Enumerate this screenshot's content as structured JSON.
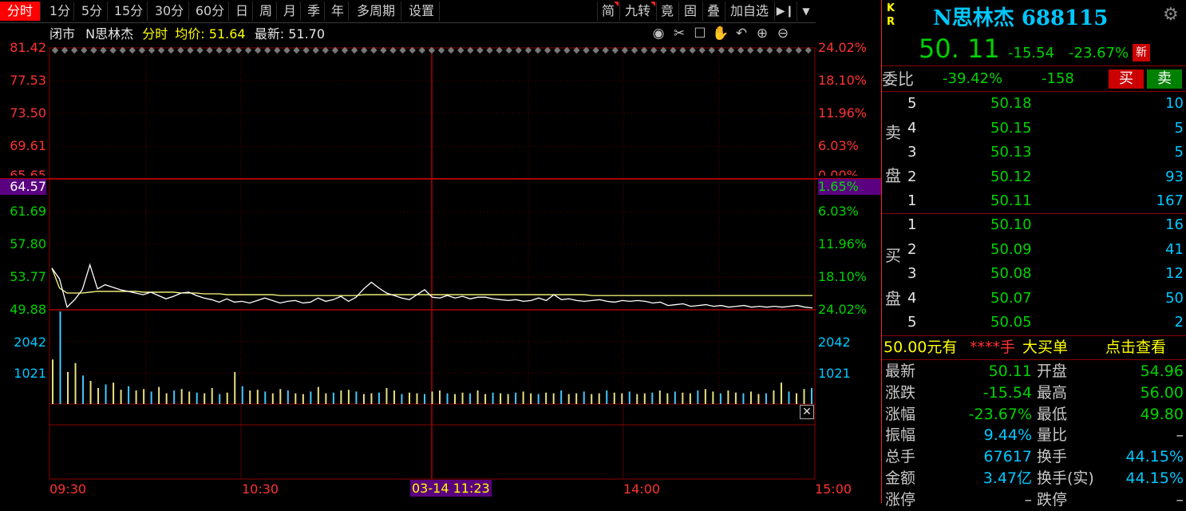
{
  "toolbar": {
    "left_items": [
      "分时",
      "1分",
      "5分",
      "15分",
      "30分",
      "60分",
      "日",
      "周",
      "月",
      "季",
      "年",
      "多周期",
      "设置"
    ],
    "right_items": [
      "简",
      "九转",
      "竟",
      "固",
      "叠",
      "加自选"
    ],
    "active": "分时"
  },
  "info": {
    "status": "闭市",
    "name": "N思林杰",
    "mode": "分时",
    "avg_label": "均价:",
    "avg_value": "51.64",
    "latest_label": "最新:",
    "latest_value": "51.70"
  },
  "left_axis": [
    "81.42",
    "77.53",
    "73.50",
    "69.61",
    "65.65",
    "64.57",
    "61.69",
    "57.80",
    "53.77",
    "49.88"
  ],
  "right_axis": [
    "24.02%",
    "18.10%",
    "11.96%",
    "6.03%",
    "0.00%",
    "1.65%",
    "6.03%",
    "11.96%",
    "18.10%",
    "24.02%"
  ],
  "volume_axis": [
    "2042",
    "1021"
  ],
  "time_axis": [
    "09:30",
    "10:30",
    "03-14 11:23",
    "14:00",
    "15:00"
  ],
  "colors": {
    "up": "#ff3232",
    "down": "#00d200",
    "price_line": "#ffffff",
    "avg_line": "#ffff80",
    "crosshair": "#8b0000",
    "grid": "#5a0000"
  },
  "chart_data": {
    "type": "line",
    "series": [
      {
        "values": [
          54.9,
          53.6,
          50.2,
          51.1,
          52.3,
          55.3,
          52.4,
          52.9,
          52.6,
          52.3,
          52.1,
          51.9,
          51.7,
          52.0,
          51.6,
          51.2,
          51.5,
          51.9,
          52.0,
          51.6,
          51.3,
          51.1,
          50.8,
          51.2,
          50.8,
          50.9,
          50.7,
          51.0,
          51.3,
          51.0,
          50.7,
          50.9,
          51.0,
          50.7,
          50.8,
          51.3,
          50.9,
          51.1,
          51.5,
          50.9,
          51.4,
          52.4,
          53.2,
          52.5,
          51.9,
          51.6,
          51.3,
          51.1,
          51.7,
          52.3,
          51.4,
          51.3,
          51.6,
          51.3,
          51.5,
          51.2,
          51.4,
          51.4,
          51.2,
          51.1,
          51.0,
          51.1,
          50.9,
          51.0,
          51.3,
          51.0,
          51.7,
          51.1,
          51.2,
          51.0,
          50.9,
          51.0,
          51.1,
          50.9,
          50.8,
          51.0,
          50.9,
          51.0,
          50.9,
          50.7,
          50.8,
          50.4,
          50.5,
          50.6,
          50.3,
          50.4,
          50.5,
          50.3,
          50.4,
          50.2,
          50.3,
          50.4,
          50.2,
          50.3,
          50.2,
          50.3,
          50.2,
          50.3,
          50.4,
          50.2,
          50.1
        ]
      },
      {
        "values": [
          54.9,
          52.5,
          51.9,
          51.9,
          51.9,
          52.0,
          52.1,
          52.1,
          52.1,
          52.1,
          52.1,
          52.1,
          52.0,
          52.0,
          52.0,
          52.0,
          52.0,
          51.9,
          51.9,
          51.9,
          51.8,
          51.8,
          51.8,
          51.7,
          51.7,
          51.7,
          51.7,
          51.7,
          51.7,
          51.7,
          51.6,
          51.6,
          51.6,
          51.6,
          51.6,
          51.6,
          51.6,
          51.6,
          51.6,
          51.6,
          51.6,
          51.7,
          51.7,
          51.7,
          51.7,
          51.7,
          51.7,
          51.7,
          51.7,
          51.7,
          51.7,
          51.7,
          51.7,
          51.7,
          51.7,
          51.7,
          51.7,
          51.7,
          51.7,
          51.7,
          51.7,
          51.7,
          51.7,
          51.7,
          51.7,
          51.7,
          51.7,
          51.7,
          51.7,
          51.7,
          51.7,
          51.6,
          51.6,
          51.6,
          51.6,
          51.6,
          51.6,
          51.6,
          51.6,
          51.6,
          51.6,
          51.6,
          51.6,
          51.6,
          51.6,
          51.6,
          51.6,
          51.6,
          51.6,
          51.6,
          51.6,
          51.6,
          51.6,
          51.6,
          51.6,
          51.6,
          51.6,
          51.6,
          51.6,
          51.6,
          51.6
        ]
      }
    ],
    "volume": [
      1250,
      2600,
      900,
      1150,
      800,
      650,
      450,
      550,
      600,
      400,
      500,
      380,
      420,
      350,
      480,
      300,
      380,
      420,
      350,
      320,
      300,
      450,
      280,
      320,
      900,
      500,
      380,
      400,
      350,
      300,
      420,
      380,
      300,
      280,
      350,
      480,
      300,
      320,
      380,
      400,
      350,
      280,
      300,
      320,
      450,
      380,
      280,
      320,
      300,
      280,
      350,
      380,
      300,
      280,
      320,
      300,
      380,
      280,
      320,
      300,
      280,
      320,
      350,
      300,
      280,
      320,
      300,
      380,
      280,
      300,
      350,
      280,
      300,
      380,
      320,
      300,
      350,
      280,
      300,
      320,
      380,
      300,
      350,
      320,
      300,
      380,
      420,
      350,
      300,
      380,
      320,
      300,
      350,
      280,
      300,
      380,
      600,
      350,
      300,
      420,
      450
    ],
    "ylim": [
      49.88,
      81.42
    ]
  },
  "quote": {
    "code_label": "N思林杰 688115",
    "kr_label": "K R",
    "price": "50. 11",
    "change": "-15.54",
    "pct": "-23.67%",
    "new_badge": "新"
  },
  "weibi": {
    "label": "委比",
    "pct": "-39.42%",
    "diff": "-158",
    "buy": "买",
    "sell": "卖"
  },
  "sell_book": [
    {
      "level": "5",
      "price": "50.18",
      "vol": "10"
    },
    {
      "level": "4",
      "price": "50.15",
      "vol": "5"
    },
    {
      "level": "3",
      "price": "50.13",
      "vol": "5"
    },
    {
      "level": "2",
      "price": "50.12",
      "vol": "93"
    },
    {
      "level": "1",
      "price": "50.11",
      "vol": "167"
    }
  ],
  "buy_book": [
    {
      "level": "1",
      "price": "50.10",
      "vol": "16"
    },
    {
      "level": "2",
      "price": "50.09",
      "vol": "41"
    },
    {
      "level": "3",
      "price": "50.08",
      "vol": "12"
    },
    {
      "level": "4",
      "price": "50.07",
      "vol": "50"
    },
    {
      "level": "5",
      "price": "50.05",
      "vol": "2"
    }
  ],
  "sell_label": [
    "卖",
    "盘"
  ],
  "buy_label": [
    "买",
    "盘"
  ],
  "big_order": {
    "price": "50.00元有",
    "stars": "****手",
    "text": "大买单",
    "link": "点击查看"
  },
  "stats": [
    {
      "l1": "最新",
      "v1": "50.11",
      "l2": "开盘",
      "v2": "54.96"
    },
    {
      "l1": "涨跌",
      "v1": "-15.54",
      "l2": "最高",
      "v2": "56.00"
    },
    {
      "l1": "涨幅",
      "v1": "-23.67%",
      "l2": "最低",
      "v2": "49.80"
    },
    {
      "l1": "振幅",
      "v1": "9.44%",
      "l2": "量比",
      "v2": "–"
    },
    {
      "l1": "总手",
      "v1": "67617",
      "l2": "换手",
      "v2": "44.15%"
    },
    {
      "l1": "金额",
      "v1": "3.47亿",
      "l2": "换手(实)",
      "v2": "44.15%"
    },
    {
      "l1": "涨停",
      "v1": "–",
      "l2": "跌停",
      "v2": "–"
    }
  ]
}
